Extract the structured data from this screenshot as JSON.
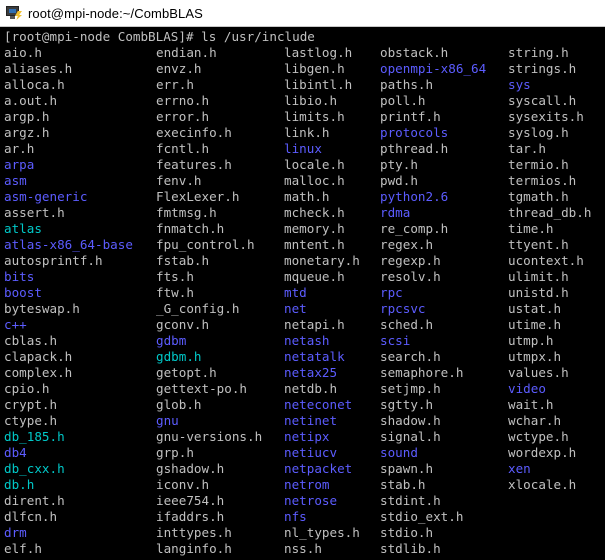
{
  "window": {
    "title": "root@mpi-node:~/CombBLAS",
    "icon": "putty-terminal-icon"
  },
  "terminal": {
    "prompt_line": "[root@mpi-node CombBLAS]# ls /usr/include",
    "colors": {
      "background": "#000000",
      "file": "#c0c0c0",
      "directory": "#5c5cff",
      "symlink": "#00c8c8"
    },
    "columns": [
      [
        {
          "t": "aio.h",
          "k": "file"
        },
        {
          "t": "aliases.h",
          "k": "file"
        },
        {
          "t": "alloca.h",
          "k": "file"
        },
        {
          "t": "a.out.h",
          "k": "file"
        },
        {
          "t": "argp.h",
          "k": "file"
        },
        {
          "t": "argz.h",
          "k": "file"
        },
        {
          "t": "ar.h",
          "k": "file"
        },
        {
          "t": "arpa",
          "k": "dir"
        },
        {
          "t": "asm",
          "k": "dir"
        },
        {
          "t": "asm-generic",
          "k": "dir"
        },
        {
          "t": "assert.h",
          "k": "file"
        },
        {
          "t": "atlas",
          "k": "link"
        },
        {
          "t": "atlas-x86_64-base",
          "k": "dir"
        },
        {
          "t": "autosprintf.h",
          "k": "file"
        },
        {
          "t": "bits",
          "k": "dir"
        },
        {
          "t": "boost",
          "k": "dir"
        },
        {
          "t": "byteswap.h",
          "k": "file"
        },
        {
          "t": "c++",
          "k": "dir"
        },
        {
          "t": "cblas.h",
          "k": "file"
        },
        {
          "t": "clapack.h",
          "k": "file"
        },
        {
          "t": "complex.h",
          "k": "file"
        },
        {
          "t": "cpio.h",
          "k": "file"
        },
        {
          "t": "crypt.h",
          "k": "file"
        },
        {
          "t": "ctype.h",
          "k": "file"
        },
        {
          "t": "db_185.h",
          "k": "link"
        },
        {
          "t": "db4",
          "k": "dir"
        },
        {
          "t": "db_cxx.h",
          "k": "link"
        },
        {
          "t": "db.h",
          "k": "link"
        },
        {
          "t": "dirent.h",
          "k": "file"
        },
        {
          "t": "dlfcn.h",
          "k": "file"
        },
        {
          "t": "drm",
          "k": "dir"
        },
        {
          "t": "elf.h",
          "k": "file"
        }
      ],
      [
        {
          "t": "endian.h",
          "k": "file"
        },
        {
          "t": "envz.h",
          "k": "file"
        },
        {
          "t": "err.h",
          "k": "file"
        },
        {
          "t": "errno.h",
          "k": "file"
        },
        {
          "t": "error.h",
          "k": "file"
        },
        {
          "t": "execinfo.h",
          "k": "file"
        },
        {
          "t": "fcntl.h",
          "k": "file"
        },
        {
          "t": "features.h",
          "k": "file"
        },
        {
          "t": "fenv.h",
          "k": "file"
        },
        {
          "t": "FlexLexer.h",
          "k": "file"
        },
        {
          "t": "fmtmsg.h",
          "k": "file"
        },
        {
          "t": "fnmatch.h",
          "k": "file"
        },
        {
          "t": "fpu_control.h",
          "k": "file"
        },
        {
          "t": "fstab.h",
          "k": "file"
        },
        {
          "t": "fts.h",
          "k": "file"
        },
        {
          "t": "ftw.h",
          "k": "file"
        },
        {
          "t": "_G_config.h",
          "k": "file"
        },
        {
          "t": "gconv.h",
          "k": "file"
        },
        {
          "t": "gdbm",
          "k": "dir"
        },
        {
          "t": "gdbm.h",
          "k": "link"
        },
        {
          "t": "getopt.h",
          "k": "file"
        },
        {
          "t": "gettext-po.h",
          "k": "file"
        },
        {
          "t": "glob.h",
          "k": "file"
        },
        {
          "t": "gnu",
          "k": "dir"
        },
        {
          "t": "gnu-versions.h",
          "k": "file"
        },
        {
          "t": "grp.h",
          "k": "file"
        },
        {
          "t": "gshadow.h",
          "k": "file"
        },
        {
          "t": "iconv.h",
          "k": "file"
        },
        {
          "t": "ieee754.h",
          "k": "file"
        },
        {
          "t": "ifaddrs.h",
          "k": "file"
        },
        {
          "t": "inttypes.h",
          "k": "file"
        },
        {
          "t": "langinfo.h",
          "k": "file"
        }
      ],
      [
        {
          "t": "lastlog.h",
          "k": "file"
        },
        {
          "t": "libgen.h",
          "k": "file"
        },
        {
          "t": "libintl.h",
          "k": "file"
        },
        {
          "t": "libio.h",
          "k": "file"
        },
        {
          "t": "limits.h",
          "k": "file"
        },
        {
          "t": "link.h",
          "k": "file"
        },
        {
          "t": "linux",
          "k": "dir"
        },
        {
          "t": "locale.h",
          "k": "file"
        },
        {
          "t": "malloc.h",
          "k": "file"
        },
        {
          "t": "math.h",
          "k": "file"
        },
        {
          "t": "mcheck.h",
          "k": "file"
        },
        {
          "t": "memory.h",
          "k": "file"
        },
        {
          "t": "mntent.h",
          "k": "file"
        },
        {
          "t": "monetary.h",
          "k": "file"
        },
        {
          "t": "mqueue.h",
          "k": "file"
        },
        {
          "t": "mtd",
          "k": "dir"
        },
        {
          "t": "net",
          "k": "dir"
        },
        {
          "t": "netapi.h",
          "k": "file"
        },
        {
          "t": "netash",
          "k": "dir"
        },
        {
          "t": "netatalk",
          "k": "dir"
        },
        {
          "t": "netax25",
          "k": "dir"
        },
        {
          "t": "netdb.h",
          "k": "file"
        },
        {
          "t": "neteconet",
          "k": "dir"
        },
        {
          "t": "netinet",
          "k": "dir"
        },
        {
          "t": "netipx",
          "k": "dir"
        },
        {
          "t": "netiucv",
          "k": "dir"
        },
        {
          "t": "netpacket",
          "k": "dir"
        },
        {
          "t": "netrom",
          "k": "dir"
        },
        {
          "t": "netrose",
          "k": "dir"
        },
        {
          "t": "nfs",
          "k": "dir"
        },
        {
          "t": "nl_types.h",
          "k": "file"
        },
        {
          "t": "nss.h",
          "k": "file"
        }
      ],
      [
        {
          "t": "obstack.h",
          "k": "file"
        },
        {
          "t": "openmpi-x86_64",
          "k": "dir"
        },
        {
          "t": "paths.h",
          "k": "file"
        },
        {
          "t": "poll.h",
          "k": "file"
        },
        {
          "t": "printf.h",
          "k": "file"
        },
        {
          "t": "protocols",
          "k": "dir"
        },
        {
          "t": "pthread.h",
          "k": "file"
        },
        {
          "t": "pty.h",
          "k": "file"
        },
        {
          "t": "pwd.h",
          "k": "file"
        },
        {
          "t": "python2.6",
          "k": "dir"
        },
        {
          "t": "rdma",
          "k": "dir"
        },
        {
          "t": "re_comp.h",
          "k": "file"
        },
        {
          "t": "regex.h",
          "k": "file"
        },
        {
          "t": "regexp.h",
          "k": "file"
        },
        {
          "t": "resolv.h",
          "k": "file"
        },
        {
          "t": "rpc",
          "k": "dir"
        },
        {
          "t": "rpcsvc",
          "k": "dir"
        },
        {
          "t": "sched.h",
          "k": "file"
        },
        {
          "t": "scsi",
          "k": "dir"
        },
        {
          "t": "search.h",
          "k": "file"
        },
        {
          "t": "semaphore.h",
          "k": "file"
        },
        {
          "t": "setjmp.h",
          "k": "file"
        },
        {
          "t": "sgtty.h",
          "k": "file"
        },
        {
          "t": "shadow.h",
          "k": "file"
        },
        {
          "t": "signal.h",
          "k": "file"
        },
        {
          "t": "sound",
          "k": "dir"
        },
        {
          "t": "spawn.h",
          "k": "file"
        },
        {
          "t": "stab.h",
          "k": "file"
        },
        {
          "t": "stdint.h",
          "k": "file"
        },
        {
          "t": "stdio_ext.h",
          "k": "file"
        },
        {
          "t": "stdio.h",
          "k": "file"
        },
        {
          "t": "stdlib.h",
          "k": "file"
        }
      ],
      [
        {
          "t": "string.h",
          "k": "file"
        },
        {
          "t": "strings.h",
          "k": "file"
        },
        {
          "t": "sys",
          "k": "dir"
        },
        {
          "t": "syscall.h",
          "k": "file"
        },
        {
          "t": "sysexits.h",
          "k": "file"
        },
        {
          "t": "syslog.h",
          "k": "file"
        },
        {
          "t": "tar.h",
          "k": "file"
        },
        {
          "t": "termio.h",
          "k": "file"
        },
        {
          "t": "termios.h",
          "k": "file"
        },
        {
          "t": "tgmath.h",
          "k": "file"
        },
        {
          "t": "thread_db.h",
          "k": "file"
        },
        {
          "t": "time.h",
          "k": "file"
        },
        {
          "t": "ttyent.h",
          "k": "file"
        },
        {
          "t": "ucontext.h",
          "k": "file"
        },
        {
          "t": "ulimit.h",
          "k": "file"
        },
        {
          "t": "unistd.h",
          "k": "file"
        },
        {
          "t": "ustat.h",
          "k": "file"
        },
        {
          "t": "utime.h",
          "k": "file"
        },
        {
          "t": "utmp.h",
          "k": "file"
        },
        {
          "t": "utmpx.h",
          "k": "file"
        },
        {
          "t": "values.h",
          "k": "file"
        },
        {
          "t": "video",
          "k": "dir"
        },
        {
          "t": "wait.h",
          "k": "file"
        },
        {
          "t": "wchar.h",
          "k": "file"
        },
        {
          "t": "wctype.h",
          "k": "file"
        },
        {
          "t": "wordexp.h",
          "k": "file"
        },
        {
          "t": "xen",
          "k": "dir"
        },
        {
          "t": "xlocale.h",
          "k": "file"
        }
      ]
    ]
  }
}
